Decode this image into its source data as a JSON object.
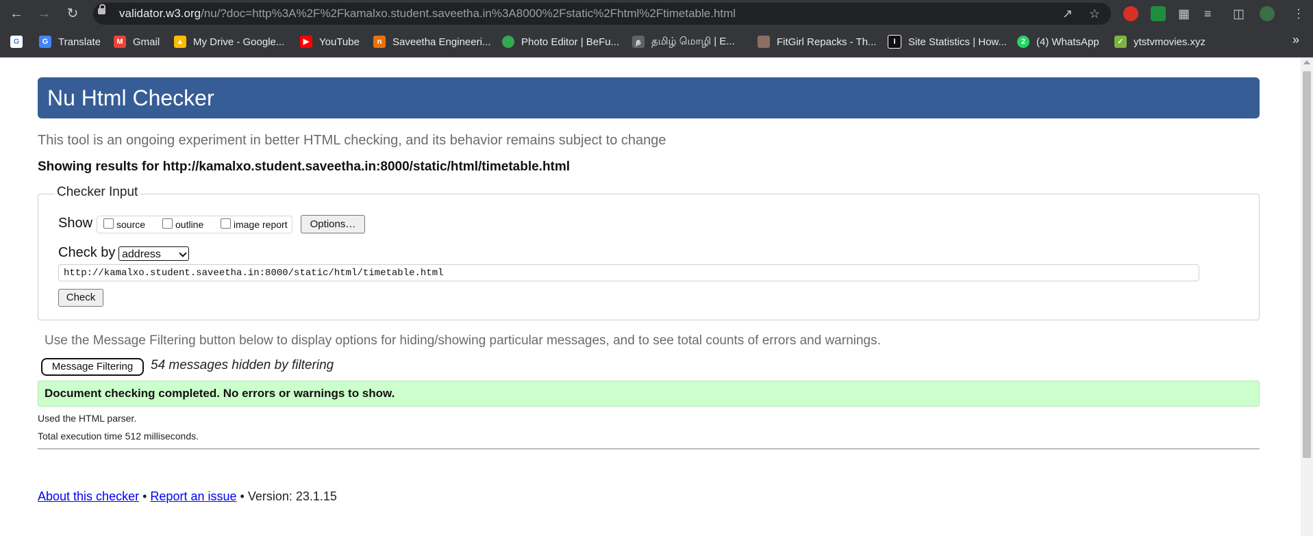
{
  "browser": {
    "url_host": "validator.w3.org",
    "url_path": "/nu/?doc=http%3A%2F%2Fkamalxo.student.saveetha.in%3A8000%2Fstatic%2Fhtml%2Ftimetable.html",
    "bookmarks": [
      {
        "label": "",
        "icon": "google-icon",
        "color": "#ffffff"
      },
      {
        "label": "Translate",
        "icon": "translate-icon",
        "color": "#4285f4"
      },
      {
        "label": "Gmail",
        "icon": "gmail-icon",
        "color": "#ea4335"
      },
      {
        "label": "My Drive - Google...",
        "icon": "drive-icon",
        "color": "#fbbc04"
      },
      {
        "label": "YouTube",
        "icon": "youtube-icon",
        "color": "#ff0000"
      },
      {
        "label": "Saveetha Engineeri...",
        "icon": "saveetha-icon",
        "color": "#e8710a"
      },
      {
        "label": "Photo Editor | BeFu...",
        "icon": "chrome-icon",
        "color": "#34a853"
      },
      {
        "label": "தமிழ் மொழி | E...",
        "icon": "tamil-icon",
        "color": "#5f6368"
      },
      {
        "label": "FitGirl Repacks - Th...",
        "icon": "fitgirl-icon",
        "color": "#8d6e63"
      },
      {
        "label": "Site Statistics | How...",
        "icon": "site-stats-icon",
        "color": "#111111"
      },
      {
        "label": "(4) WhatsApp",
        "icon": "whatsapp-icon",
        "color": "#25d366"
      },
      {
        "label": "ytstvmovies.xyz",
        "icon": "ytstv-icon",
        "color": "#7cb342"
      }
    ],
    "more_bookmarks": "»"
  },
  "page": {
    "title": "Nu Html Checker",
    "intro": "This tool is an ongoing experiment in better HTML checking, and its behavior remains subject to change",
    "results_for": "Showing results for http://kamalxo.student.saveetha.in:8000/static/html/timetable.html",
    "checker_input": {
      "legend": "Checker Input",
      "show_label": "Show",
      "options": [
        {
          "label": "source",
          "checked": false
        },
        {
          "label": "outline",
          "checked": false
        },
        {
          "label": "image report",
          "checked": false
        }
      ],
      "options_button": "Options…",
      "check_by_label": "Check by",
      "check_by_value": "address",
      "address_value": "http://kamalxo.student.saveetha.in:8000/static/html/timetable.html",
      "check_button": "Check"
    },
    "filter_help": "Use the Message Filtering button below to display options for hiding/showing particular messages, and to see total counts of errors and warnings.",
    "filter_button": "Message Filtering",
    "hidden_count": "54 messages hidden by filtering",
    "success_message": "Document checking completed. No errors or warnings to show.",
    "parser_info": "Used the HTML parser.",
    "execution_time": "Total execution time 512 milliseconds.",
    "footer": {
      "about_link": "About this checker",
      "separator": "•",
      "report_link": "Report an issue",
      "version": "Version: 23.1.15"
    }
  },
  "colors": {
    "banner": "#365d95",
    "success_bg": "#ccffcc",
    "link": "#0000ee"
  }
}
